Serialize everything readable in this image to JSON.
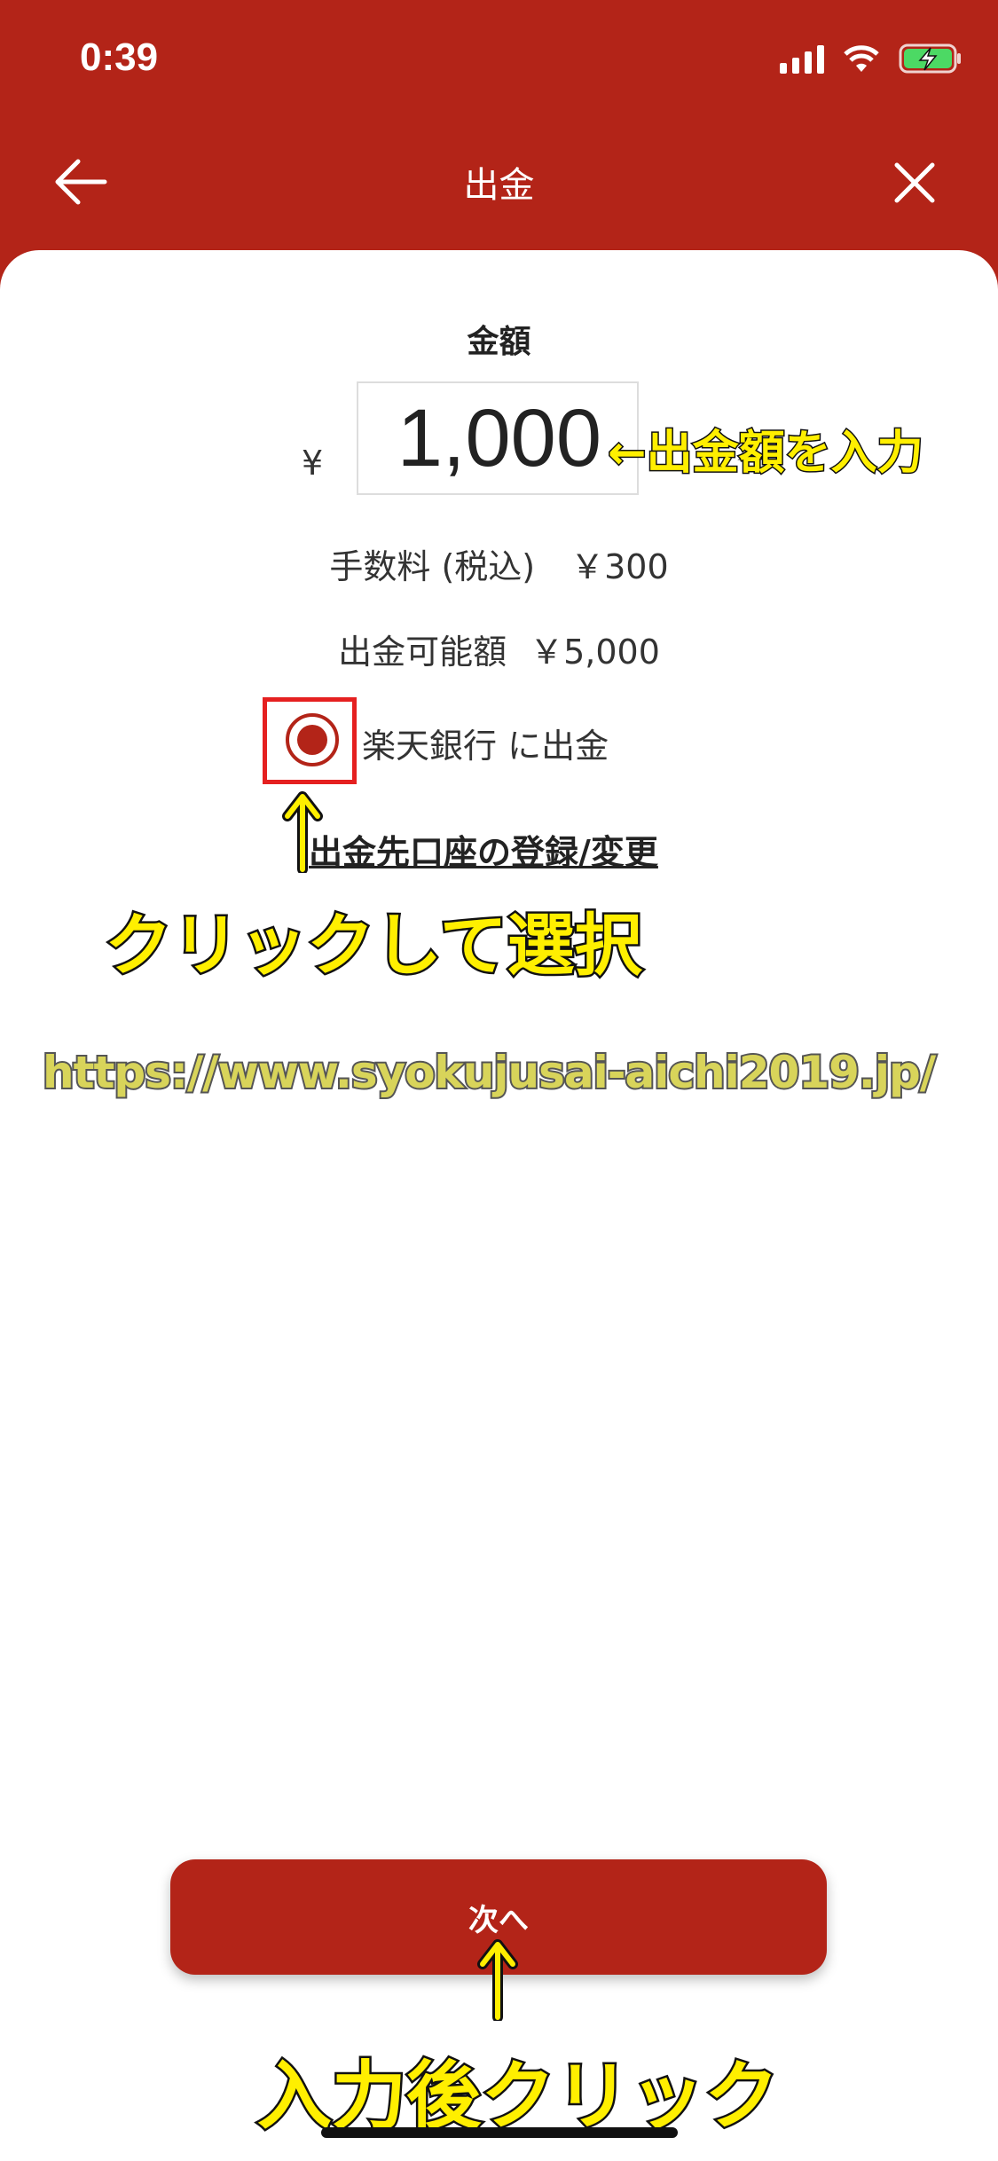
{
  "status_bar": {
    "time": "0:39",
    "icons": [
      "signal-icon",
      "wifi-icon",
      "battery-charging-icon"
    ]
  },
  "header": {
    "title": "出金",
    "back_icon": "arrow-left-icon",
    "close_icon": "close-icon",
    "color": "#b32418"
  },
  "amount": {
    "label": "金額",
    "currency": "¥",
    "value": "1,000"
  },
  "fee": {
    "label": "手数料 (税込)",
    "value": "￥300"
  },
  "available": {
    "label": "出金可能額",
    "value": "￥5,000"
  },
  "bank_option": {
    "label": "楽天銀行 に出金",
    "selected": true
  },
  "account_link": "出金先口座の登録/変更",
  "annotations": {
    "amount_note": "←出金額を入力",
    "click_note": "クリックして選択",
    "next_note": "入力後クリック",
    "watermark": "https://www.syokujusai-aichi2019.jp/",
    "highlight_color": "#ffef00"
  },
  "next_button": {
    "label": "次へ"
  }
}
